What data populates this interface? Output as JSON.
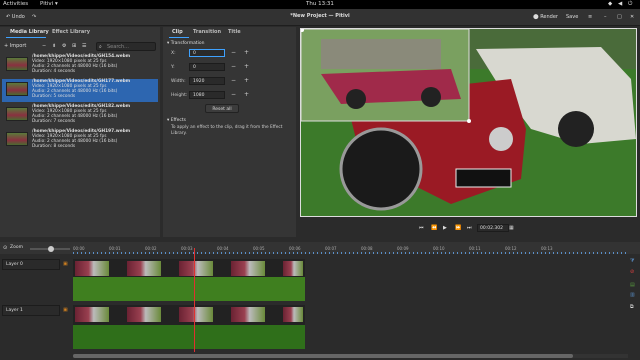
{
  "topbar": {
    "activities": "Activities",
    "app": "Pitivi",
    "clock": "Thu 13:31"
  },
  "header": {
    "undo": "Undo",
    "title": "*New Project — Pitivi",
    "render": "Render",
    "save": "Save"
  },
  "library": {
    "tabs": [
      "Media Library",
      "Effect Library"
    ],
    "import": "Import",
    "search_placeholder": "Search...",
    "clips": [
      {
        "path": "/home/khippe/Videos/edits/GH154.webm",
        "video": "Video: 1920×1080 pixels at 25 fps",
        "audio": "Audio: 2 channels at 48000 Hz (16 bits)",
        "duration": "Duration: 4 seconds"
      },
      {
        "path": "/home/khippe/Videos/edits/GH177.webm",
        "video": "Video: 1920×1080 pixels at 25 fps",
        "audio": "Audio: 2 channels at 48000 Hz (16 bits)",
        "duration": "Duration: 5 seconds"
      },
      {
        "path": "/home/khippe/Videos/edits/GH182.webm",
        "video": "Video: 1920×1080 pixels at 25 fps",
        "audio": "Audio: 2 channels at 48000 Hz (16 bits)",
        "duration": "Duration: 7 seconds"
      },
      {
        "path": "/home/khippe/Videos/edits/GH197.webm",
        "video": "Video: 1920×1080 pixels at 25 fps",
        "audio": "Audio: 2 channels at 48000 Hz (16 bits)",
        "duration": "Duration: 8 seconds"
      }
    ]
  },
  "clipprops": {
    "tabs": [
      "Clip",
      "Transition",
      "Title"
    ],
    "transformation": "Transformation",
    "fields": [
      {
        "label": "X:",
        "value": "0"
      },
      {
        "label": "Y:",
        "value": "0"
      },
      {
        "label": "Width:",
        "value": "1920"
      },
      {
        "label": "Height:",
        "value": "1080"
      }
    ],
    "reset": "Reset all",
    "effects": "Effects",
    "effects_hint": "To apply an effect to the clip, drag it from the Effect Library."
  },
  "viewer": {
    "timecode": "00:02.302"
  },
  "timeline": {
    "zoom": "Zoom",
    "layers": [
      "Layer 0",
      "Layer 1"
    ],
    "ticks": [
      "00:00",
      "00:01",
      "00:02",
      "00:03",
      "00:04",
      "00:05",
      "00:06",
      "00:07",
      "00:08",
      "00:09",
      "00:10",
      "00:11",
      "00:12",
      "00:13"
    ]
  }
}
